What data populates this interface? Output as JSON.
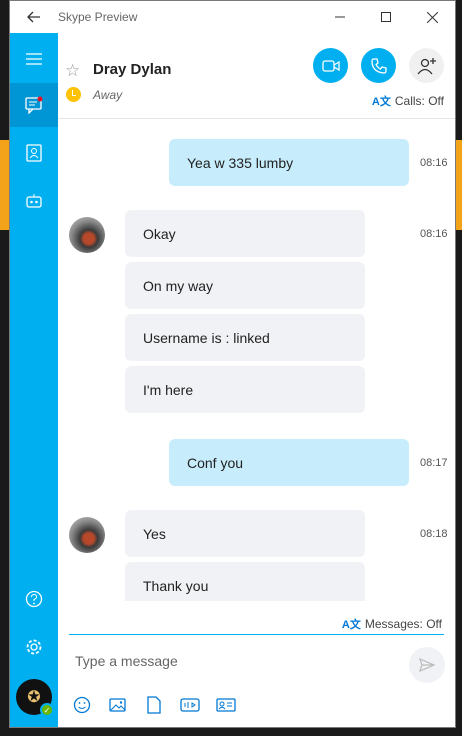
{
  "window": {
    "title": "Skype Preview"
  },
  "contact": {
    "name": "Dray Dylan",
    "status": "Away"
  },
  "header": {
    "calls_setting": "Calls: Off"
  },
  "messages": [
    {
      "direction": "out",
      "text": "Yea w 335 lumby",
      "time": "08:16"
    },
    {
      "direction": "in",
      "text": "Okay",
      "time": "08:16"
    },
    {
      "direction": "in",
      "text": "On my way",
      "time": ""
    },
    {
      "direction": "in",
      "text": "Username is : linked",
      "time": ""
    },
    {
      "direction": "in",
      "text": "I'm here",
      "time": ""
    },
    {
      "direction": "out",
      "text": "Conf you",
      "time": "08:17"
    },
    {
      "direction": "in",
      "text": "Yes",
      "time": "08:18"
    },
    {
      "direction": "in",
      "text": "Thank you",
      "time": ""
    }
  ],
  "composer": {
    "messages_setting": "Messages: Off",
    "placeholder": "Type a message"
  },
  "colors": {
    "accent": "#00aff0",
    "outgoing_bubble": "#c7edfc",
    "incoming_bubble": "#f1f2f5"
  },
  "icons": {
    "sidebar": [
      "hamburger-menu-icon",
      "chats-icon",
      "contacts-icon",
      "bots-icon",
      "help-icon",
      "settings-icon"
    ],
    "header": [
      "favorite-star-icon",
      "away-clock-icon",
      "video-call-icon",
      "audio-call-icon",
      "add-people-icon"
    ],
    "toolbar": [
      "emoticon-icon",
      "image-icon",
      "file-icon",
      "video-message-icon",
      "contact-card-icon",
      "send-icon"
    ]
  }
}
